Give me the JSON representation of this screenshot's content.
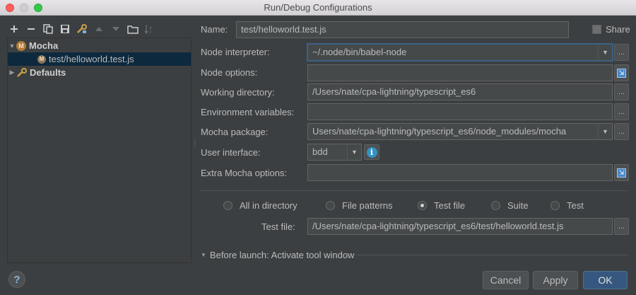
{
  "window": {
    "title": "Run/Debug Configurations"
  },
  "toolbar": {
    "icons": [
      "plus-icon",
      "minus-icon",
      "copy-icon",
      "save-icon",
      "wrench-icon",
      "arrow-up-icon",
      "arrow-down-icon",
      "folder-icon",
      "sort-icon"
    ]
  },
  "tree": {
    "mocha": {
      "label": "Mocha",
      "icon": "M"
    },
    "config": {
      "label": "test/helloworld.test.js",
      "icon": "M"
    },
    "defaults": {
      "label": "Defaults"
    }
  },
  "form": {
    "name_label": "Name:",
    "name_value": "test/helloworld.test.js",
    "share_label": "Share",
    "node_interpreter_label": "Node interpreter:",
    "node_interpreter_value": "~/.node/bin/babel-node",
    "node_options_label": "Node options:",
    "node_options_value": "",
    "working_dir_label": "Working directory:",
    "working_dir_value": "/Users/nate/cpa-lightning/typescript_es6",
    "env_label": "Environment variables:",
    "env_value": "",
    "mocha_pkg_label": "Mocha package:",
    "mocha_pkg_value": "Users/nate/cpa-lightning/typescript_es6/node_modules/mocha",
    "ui_label": "User interface:",
    "ui_value": "bdd",
    "extra_label": "Extra Mocha options:",
    "extra_value": ""
  },
  "test_kind": {
    "options": [
      "All in directory",
      "File patterns",
      "Test file",
      "Suite",
      "Test"
    ],
    "selected": "Test file",
    "test_file_label": "Test file:",
    "test_file_value": "/Users/nate/cpa-lightning/typescript_es6/test/helloworld.test.js"
  },
  "before_launch": {
    "label": "Before launch: Activate tool window"
  },
  "buttons": {
    "cancel": "Cancel",
    "apply": "Apply",
    "ok": "OK",
    "help": "?"
  },
  "glyphs": {
    "dots": "...",
    "info": "i",
    "dd": "▼",
    "expand": "⇲"
  }
}
